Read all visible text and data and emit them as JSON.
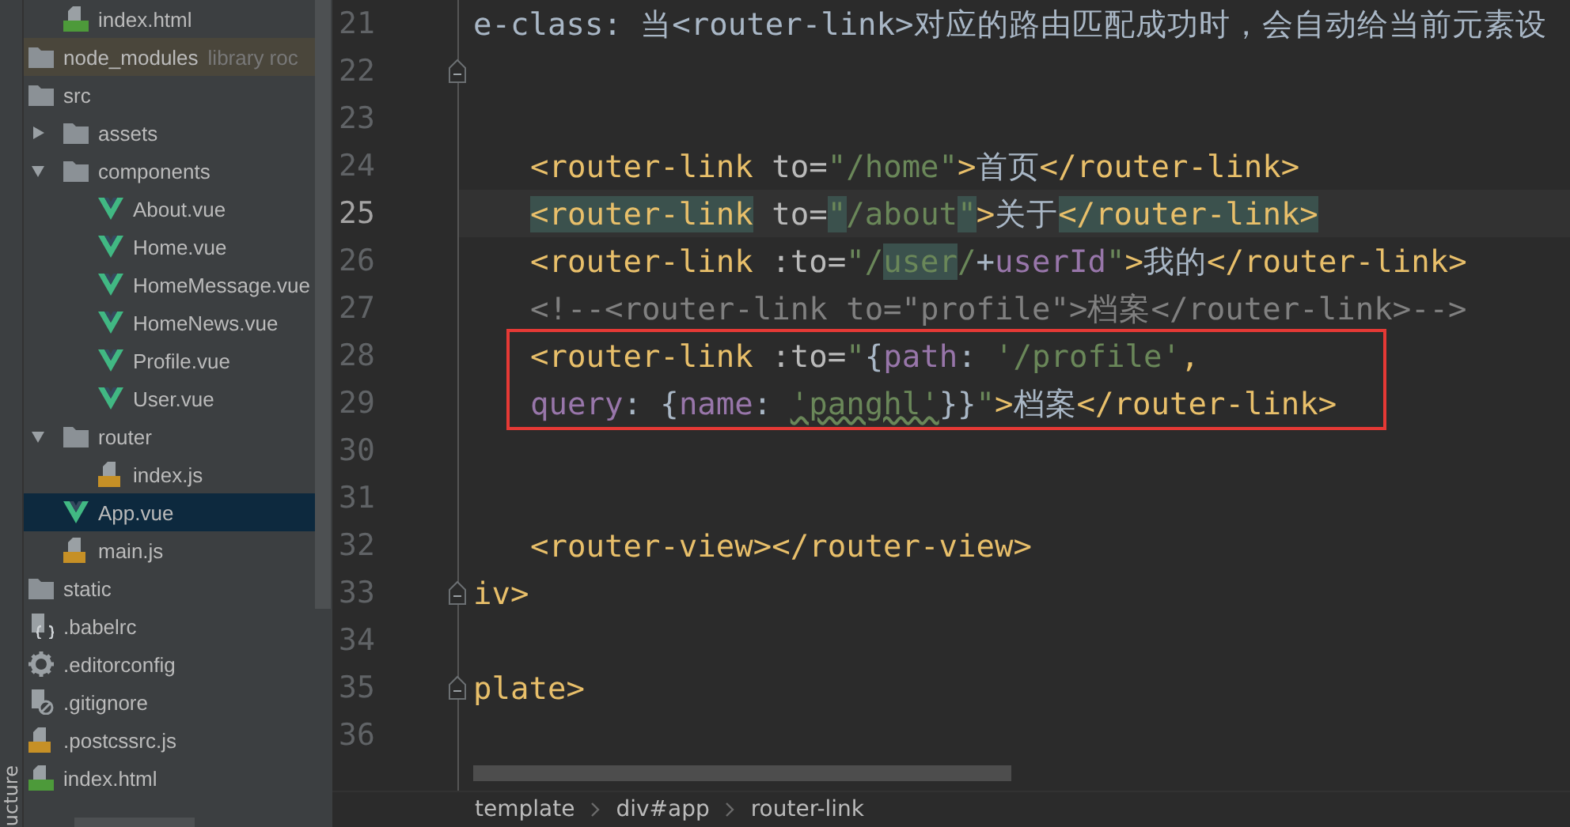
{
  "side_tab": "ucture",
  "tree": [
    {
      "children": [
        {
          "name": "index.html",
          "kind": "html",
          "selected": false
        }
      ]
    },
    {
      "name": "node_modules",
      "kind": "folder",
      "hint": "library roc",
      "excluded": true,
      "selected": false
    },
    {
      "name": "src",
      "kind": "folder",
      "selected": false,
      "children": [
        {
          "name": "assets",
          "kind": "folder",
          "expanded": false,
          "selected": false
        },
        {
          "name": "components",
          "kind": "folder",
          "expanded": true,
          "selected": false,
          "children": [
            {
              "name": "About.vue",
              "kind": "vue",
              "selected": false
            },
            {
              "name": "Home.vue",
              "kind": "vue",
              "selected": false
            },
            {
              "name": "HomeMessage.vue",
              "kind": "vue",
              "selected": false
            },
            {
              "name": "HomeNews.vue",
              "kind": "vue",
              "selected": false
            },
            {
              "name": "Profile.vue",
              "kind": "vue",
              "selected": false
            },
            {
              "name": "User.vue",
              "kind": "vue",
              "selected": false
            }
          ]
        },
        {
          "name": "router",
          "kind": "folder",
          "expanded": true,
          "selected": false,
          "children": [
            {
              "name": "index.js",
              "kind": "js",
              "selected": false
            }
          ]
        },
        {
          "name": "App.vue",
          "kind": "vue",
          "selected": true
        },
        {
          "name": "main.js",
          "kind": "js",
          "selected": false
        }
      ]
    },
    {
      "name": "static",
      "kind": "folder",
      "selected": false
    },
    {
      "name": ".babelrc",
      "kind": "babel",
      "selected": false
    },
    {
      "name": ".editorconfig",
      "kind": "gear",
      "selected": false
    },
    {
      "name": ".gitignore",
      "kind": "ignore",
      "selected": false
    },
    {
      "name": ".postcssrc.js",
      "kind": "js",
      "selected": false
    },
    {
      "name": "index.html",
      "kind": "html",
      "selected": false
    }
  ],
  "code_lines": [
    {
      "number": "21",
      "tokens": [
        {
          "text": "e-class: 当<router-link>对应的路由匹配成功时，会自动给当前元素设",
          "kind": "plain"
        }
      ]
    },
    {
      "number": "22",
      "fold": true
    },
    {
      "number": "23"
    },
    {
      "number": "24",
      "indented": true,
      "tokens": [
        {
          "text": "<router-link ",
          "kind": "tag"
        },
        {
          "text": "to=",
          "kind": "attr"
        },
        {
          "text": "\"/home\"",
          "kind": "str"
        },
        {
          "text": ">",
          "kind": "tag"
        },
        {
          "text": "首页",
          "kind": "plain"
        },
        {
          "text": "</router-link>",
          "kind": "tag"
        }
      ]
    },
    {
      "number": "25",
      "current": true,
      "indented": true,
      "tokens": [
        {
          "text": "<router-link",
          "kind": "tag",
          "highlight": true
        },
        {
          "text": " to=",
          "kind": "attr"
        },
        {
          "text": "\"",
          "kind": "str",
          "highlight": true
        },
        {
          "text": "/about",
          "kind": "str"
        },
        {
          "text": "\"",
          "kind": "str",
          "highlight": true
        },
        {
          "text": ">",
          "kind": "tag"
        },
        {
          "text": "关于",
          "kind": "plain"
        },
        {
          "text": "</router-link>",
          "kind": "tag",
          "highlight": true
        }
      ]
    },
    {
      "number": "26",
      "indented": true,
      "tokens": [
        {
          "text": "<router-link ",
          "kind": "tag"
        },
        {
          "text": ":to=",
          "kind": "attr"
        },
        {
          "text": "\"/",
          "kind": "str"
        },
        {
          "text": "user",
          "kind": "str",
          "highlight": true
        },
        {
          "text": "/",
          "kind": "str"
        },
        {
          "text": "+",
          "kind": "plain"
        },
        {
          "text": "userId",
          "kind": "ident"
        },
        {
          "text": "\"",
          "kind": "str"
        },
        {
          "text": ">",
          "kind": "tag"
        },
        {
          "text": "我的",
          "kind": "plain"
        },
        {
          "text": "</router-link>",
          "kind": "tag"
        }
      ]
    },
    {
      "number": "27",
      "indented": true,
      "tokens": [
        {
          "text": "<!--<router-link to=\"profile\">档案</router-link>-->",
          "kind": "comment"
        }
      ]
    },
    {
      "number": "28",
      "indented": true,
      "boxed": true,
      "tokens": [
        {
          "text": "<router-link ",
          "kind": "tag"
        },
        {
          "text": ":to=",
          "kind": "attr"
        },
        {
          "text": "\"",
          "kind": "str"
        },
        {
          "text": "{",
          "kind": "plain"
        },
        {
          "text": "path",
          "kind": "ident"
        },
        {
          "text": ": ",
          "kind": "plain"
        },
        {
          "text": "'/profile'",
          "kind": "str"
        },
        {
          "text": ",",
          "kind": "tag"
        }
      ]
    },
    {
      "number": "29",
      "indented": true,
      "boxed": true,
      "tokens": [
        {
          "text": "query",
          "kind": "ident"
        },
        {
          "text": ": {",
          "kind": "plain"
        },
        {
          "text": "name",
          "kind": "ident"
        },
        {
          "text": ": ",
          "kind": "plain"
        },
        {
          "text": "'panghl'",
          "kind": "str",
          "typo": true
        },
        {
          "text": "}}",
          "kind": "plain"
        },
        {
          "text": "\"",
          "kind": "str"
        },
        {
          "text": ">",
          "kind": "tag"
        },
        {
          "text": "档案",
          "kind": "plain"
        },
        {
          "text": "</router-link>",
          "kind": "tag"
        }
      ]
    },
    {
      "number": "30"
    },
    {
      "number": "31"
    },
    {
      "number": "32",
      "indented": true,
      "tokens": [
        {
          "text": "<router-view></router-view>",
          "kind": "tag"
        }
      ]
    },
    {
      "number": "33",
      "fold": true,
      "tokens": [
        {
          "text": "iv>",
          "kind": "tag"
        }
      ]
    },
    {
      "number": "34"
    },
    {
      "number": "35",
      "fold": true,
      "tokens": [
        {
          "text": "plate>",
          "kind": "tag"
        }
      ]
    },
    {
      "number": "36"
    }
  ],
  "breadcrumb": [
    "template",
    "div#app",
    "router-link"
  ]
}
